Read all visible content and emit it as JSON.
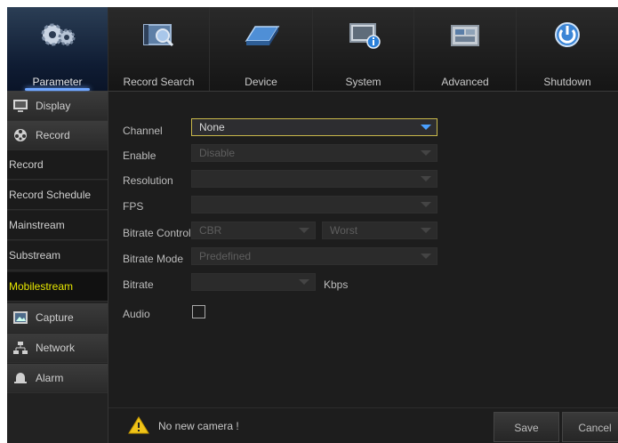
{
  "tabs": [
    {
      "label": "Parameter",
      "icon": "gears-icon"
    },
    {
      "label": "Record Search",
      "icon": "film-search-icon"
    },
    {
      "label": "Device",
      "icon": "hard-drive-icon"
    },
    {
      "label": "System",
      "icon": "monitor-info-icon"
    },
    {
      "label": "Advanced",
      "icon": "advanced-panel-icon"
    },
    {
      "label": "Shutdown",
      "icon": "power-icon"
    }
  ],
  "sidebar": {
    "display": "Display",
    "record": "Record",
    "sub_record": "Record",
    "record_schedule": "Record Schedule",
    "mainstream": "Mainstream",
    "substream": "Substream",
    "mobilestream": "Mobilestream",
    "capture": "Capture",
    "network": "Network",
    "alarm": "Alarm"
  },
  "form": {
    "channel_label": "Channel",
    "channel_value": "None",
    "enable_label": "Enable",
    "enable_value": "Disable",
    "resolution_label": "Resolution",
    "resolution_value": "",
    "fps_label": "FPS",
    "fps_value": "",
    "bitrate_control_label": "Bitrate Control",
    "bitrate_control_value": "CBR",
    "quality_value": "Worst",
    "bitrate_mode_label": "Bitrate Mode",
    "bitrate_mode_value": "Predefined",
    "bitrate_label": "Bitrate",
    "bitrate_value": "",
    "bitrate_unit": "Kbps",
    "audio_label": "Audio",
    "audio_checked": false
  },
  "status": {
    "message": "No new camera !",
    "save": "Save",
    "cancel": "Cancel"
  },
  "colors": {
    "highlight": "#e6e600",
    "accent": "#4aa0ff"
  }
}
